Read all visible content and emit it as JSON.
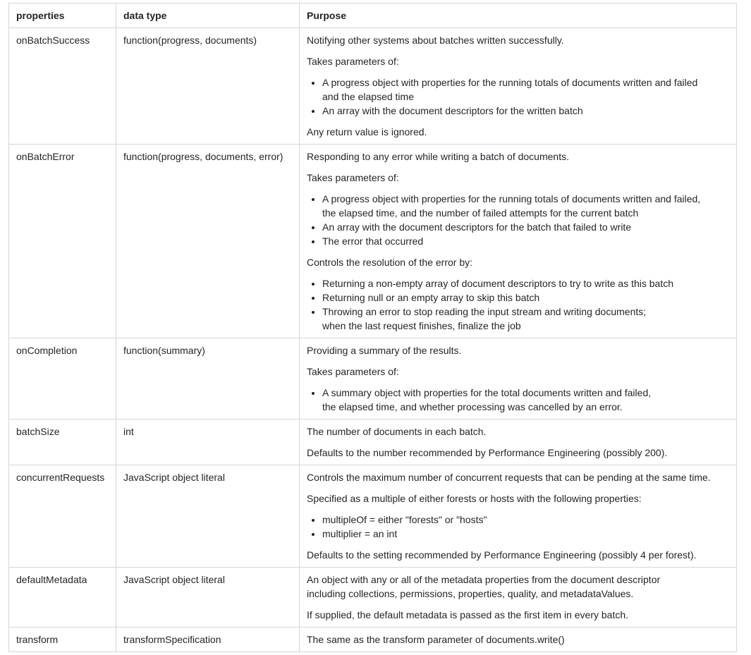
{
  "headers": [
    "properties",
    "data type",
    "Purpose"
  ],
  "rows": [
    {
      "property": "onBatchSuccess",
      "type": "function(progress, documents)",
      "blocks": [
        {
          "p": "Notifying other systems about batches written successfully."
        },
        {
          "p": "Takes parameters of:"
        },
        {
          "ul": [
            "A progress object with properties for the running totals of documents written and failed\nand the elapsed time",
            "An array with the document descriptors for the written batch"
          ]
        },
        {
          "p": "Any return value is ignored."
        }
      ]
    },
    {
      "property": "onBatchError",
      "type": "function(progress, documents, error)",
      "blocks": [
        {
          "p": "Responding to any error while writing a batch of documents."
        },
        {
          "p": "Takes parameters of:"
        },
        {
          "ul": [
            "A progress object with properties for the running totals of documents written and failed,\nthe elapsed time, and the number of failed attempts for the current batch",
            "An array with the document descriptors for the batch that failed to write",
            "The error that occurred"
          ]
        },
        {
          "p": "Controls the resolution of the error by:"
        },
        {
          "ul": [
            "Returning a non-empty array of document descriptors to try to write as this batch",
            "Returning null or an empty array to skip this batch",
            "Throwing an error to stop reading the input stream and writing documents;\nwhen the last request finishes, finalize the job"
          ]
        }
      ]
    },
    {
      "property": "onCompletion",
      "type": "function(summary)",
      "blocks": [
        {
          "p": "Providing a summary of the results."
        },
        {
          "p": "Takes parameters of:"
        },
        {
          "ul": [
            "A summary object with properties for the total documents written and failed,\nthe elapsed time, and whether processing was cancelled by an error."
          ]
        }
      ]
    },
    {
      "property": "batchSize",
      "type": "int",
      "blocks": [
        {
          "p": "The number of documents in each batch."
        },
        {
          "p": "Defaults to the number recommended by Performance Engineering (possibly 200)."
        }
      ]
    },
    {
      "property": "concurrentRequests",
      "type": "JavaScript object literal",
      "blocks": [
        {
          "p": "Controls the maximum number of concurrent requests that can be pending at the same time."
        },
        {
          "p": "Specified as a multiple of either forests or hosts with the following properties:"
        },
        {
          "ul": [
            "multipleOf = either \"forests\" or \"hosts\"",
            "multiplier = an int"
          ]
        },
        {
          "p": "Defaults to the setting recommended by Performance Engineering (possibly 4 per forest)."
        }
      ]
    },
    {
      "property": "defaultMetadata",
      "type": "JavaScript object literal",
      "blocks": [
        {
          "p": "An object with any or all of the metadata properties from the document descriptor\nincluding collections, permissions, properties, quality, and metadataValues."
        },
        {
          "p": "If supplied, the default metadata is passed as the first item in every batch."
        }
      ]
    },
    {
      "property": "transform",
      "type": "transformSpecification",
      "blocks": [
        {
          "p": "The same as the transform parameter of documents.write()"
        }
      ]
    }
  ]
}
